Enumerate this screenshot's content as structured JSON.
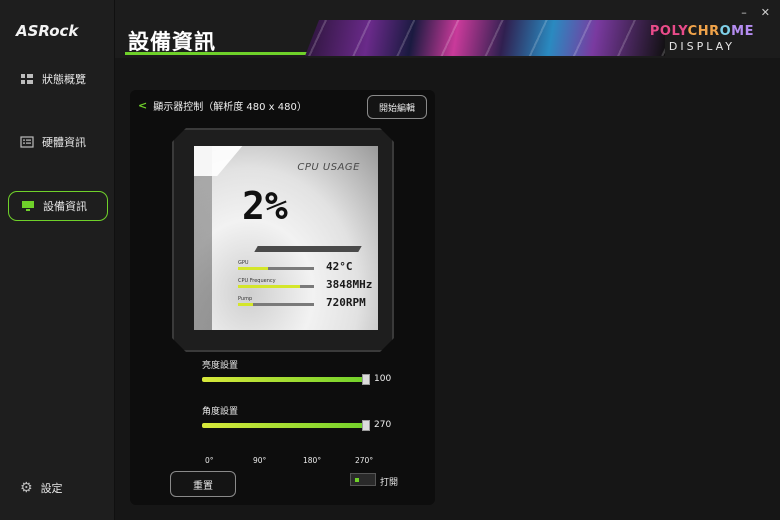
{
  "app": {
    "logo": "ASRock",
    "page_title": "設備資訊",
    "brand_poly": [
      "POLY",
      "CHR",
      "O",
      "ME"
    ],
    "brand_display": "DISPLAY"
  },
  "sidebar": {
    "items": [
      {
        "label": "狀態概覽",
        "icon": "grid-icon"
      },
      {
        "label": "硬體資訊",
        "icon": "list-icon"
      },
      {
        "label": "設備資訊",
        "icon": "monitor-icon"
      }
    ],
    "settings_label": "設定"
  },
  "panel": {
    "title": "顯示器控制（解析度 480 x 480）",
    "edit_button": "開始編輯",
    "screen": {
      "title": "CPU USAGE",
      "value": "2%",
      "metrics": [
        {
          "label": "GPU",
          "value": "42°C",
          "fill": 0.4
        },
        {
          "label": "CPU Frequency",
          "value": "3848MHz",
          "fill": 0.82
        },
        {
          "label": "Pump",
          "value": "720RPM",
          "fill": 0.2
        }
      ]
    },
    "brightness": {
      "label": "亮度設置",
      "value": "100",
      "fraction": 1.0
    },
    "rotation": {
      "label": "角度設置",
      "value": "270",
      "fraction": 1.0,
      "ticks": [
        "0°",
        "90°",
        "180°",
        "270°"
      ]
    },
    "reset_button": "重置",
    "toggle_label": "打開"
  },
  "colors": {
    "accent": "#6fd12a",
    "slider_start": "#d8e83a"
  }
}
